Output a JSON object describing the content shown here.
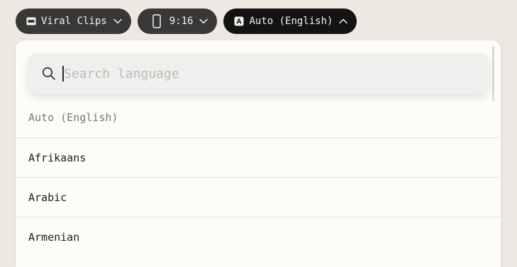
{
  "toolbar": {
    "project": {
      "label": "Viral Clips",
      "icon": "film-icon"
    },
    "aspect": {
      "label": "9:16",
      "icon": "phone-portrait-icon"
    },
    "language": {
      "label": "Auto (English)",
      "icon": "translate-icon",
      "expanded": true
    }
  },
  "dropdown": {
    "search": {
      "placeholder": "Search language",
      "value": ""
    },
    "items": [
      {
        "label": "Auto (English)",
        "selected": true
      },
      {
        "label": "Afrikaans"
      },
      {
        "label": "Arabic"
      },
      {
        "label": "Armenian"
      }
    ]
  },
  "colors": {
    "background": "#ece8e2",
    "panel": "#fdfcf7",
    "pill_grey": "#3a3836",
    "pill_black": "#141312",
    "search_bg": "#f0efed"
  }
}
